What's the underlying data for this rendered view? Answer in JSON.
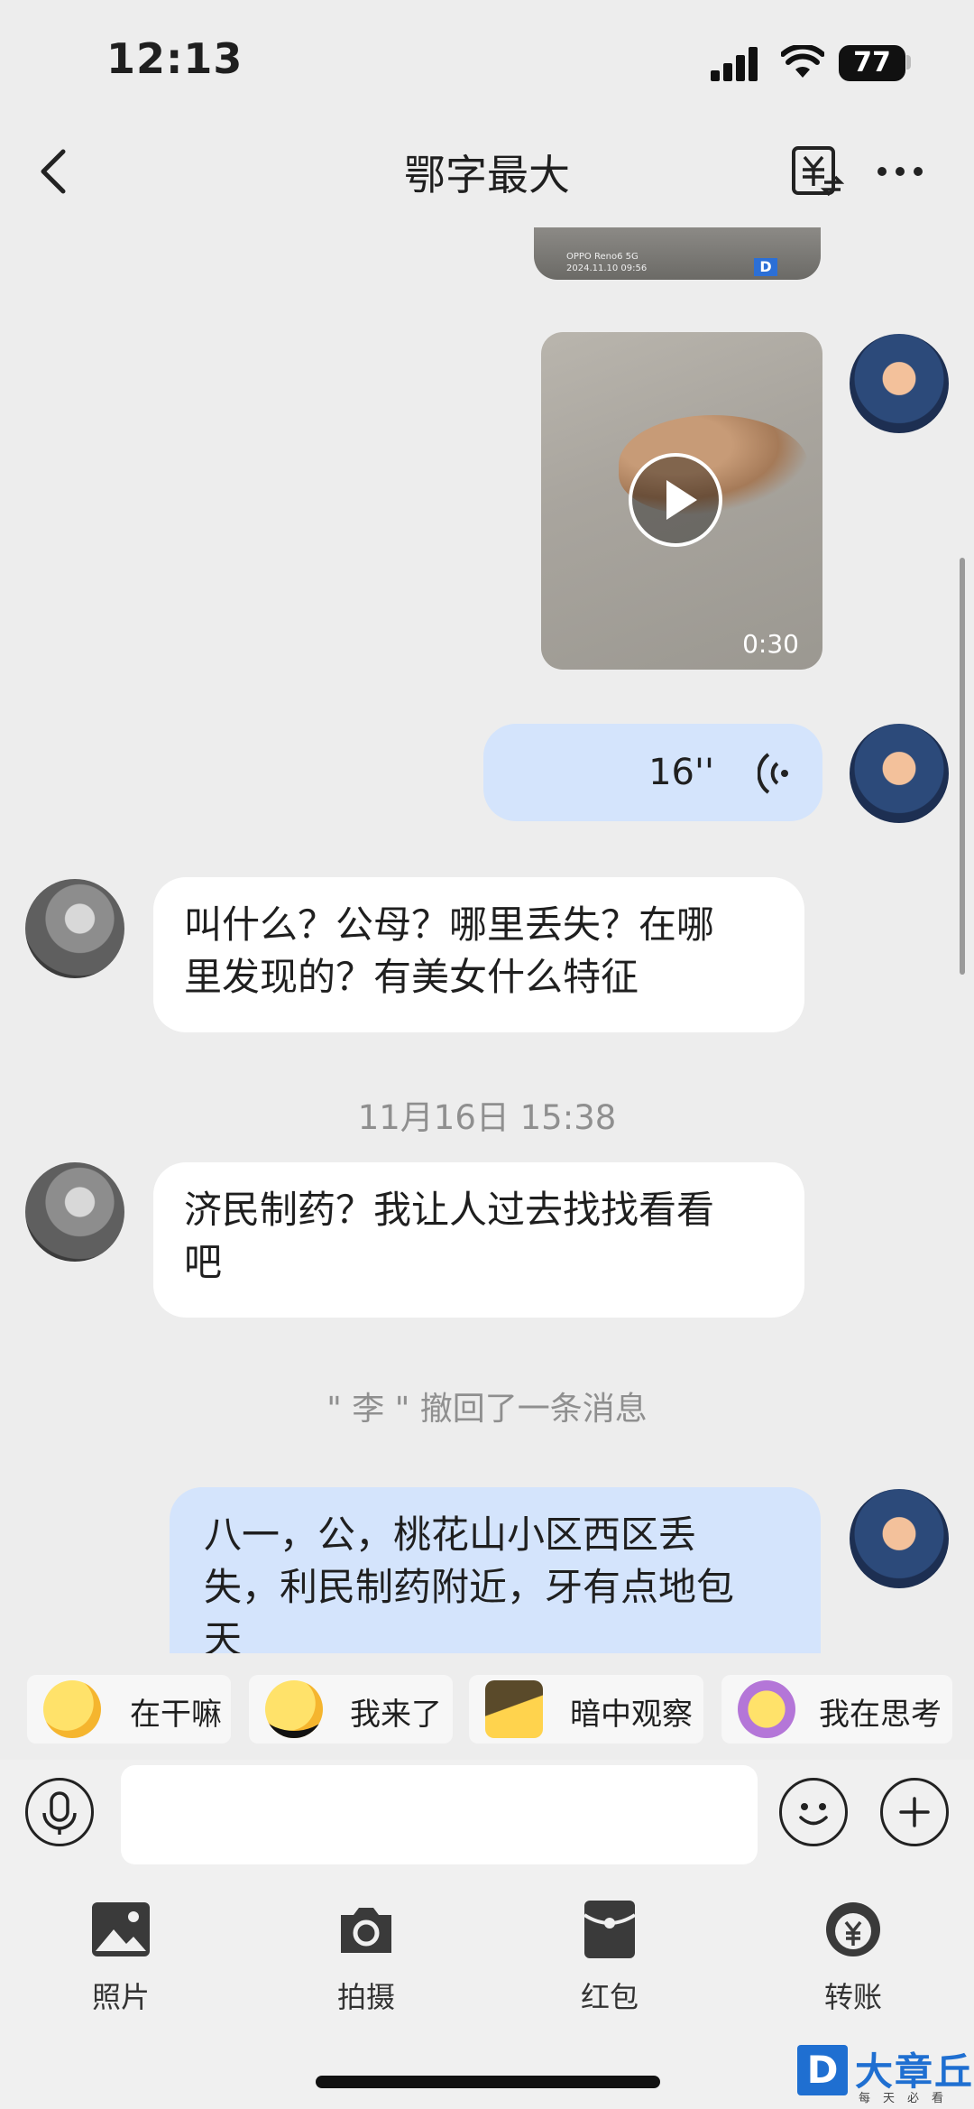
{
  "status_bar": {
    "time": "12:13",
    "battery": "77"
  },
  "header": {
    "title": "鄂字最大"
  },
  "messages": {
    "video_caption_line1": "OPPO Reno6 5G",
    "video_caption_line2": "2024.11.10 09:56",
    "video_duration": "0:30",
    "voice_duration": "16''",
    "msg1_line1": "叫什么？公母？哪里丢失？在哪",
    "msg1_line2": "里发现的？有美女什么特征",
    "timestamp": "11月16日 15:38",
    "msg2_line1": "济民制药？我让人过去找找看看",
    "msg2_line2": "吧",
    "recall_notice": "\" 李 \" 撤回了一条消息",
    "msg3_line1": "八一，公，桃花山小区西区丢",
    "msg3_line2": "失，利民制药附近，牙有点地包",
    "msg3_line3": "天"
  },
  "emoji_suggestions": [
    {
      "label": "在干嘛",
      "icon": "surprised-face-icon"
    },
    {
      "label": "我来了",
      "icon": "sunglasses-face-icon"
    },
    {
      "label": "暗中观察",
      "icon": "peeking-face-icon"
    },
    {
      "label": "我在思考",
      "icon": "thinking-face-icon"
    }
  ],
  "input": {
    "placeholder": ""
  },
  "toolbar": {
    "photo": "照片",
    "camera": "拍摄",
    "red_packet": "红包",
    "transfer": "转账"
  },
  "watermark": {
    "name": "大章丘",
    "sub": "每天必看"
  },
  "colors": {
    "my_bubble": "#d4e4fc",
    "other_bubble": "#ffffff",
    "background": "#ededed"
  }
}
